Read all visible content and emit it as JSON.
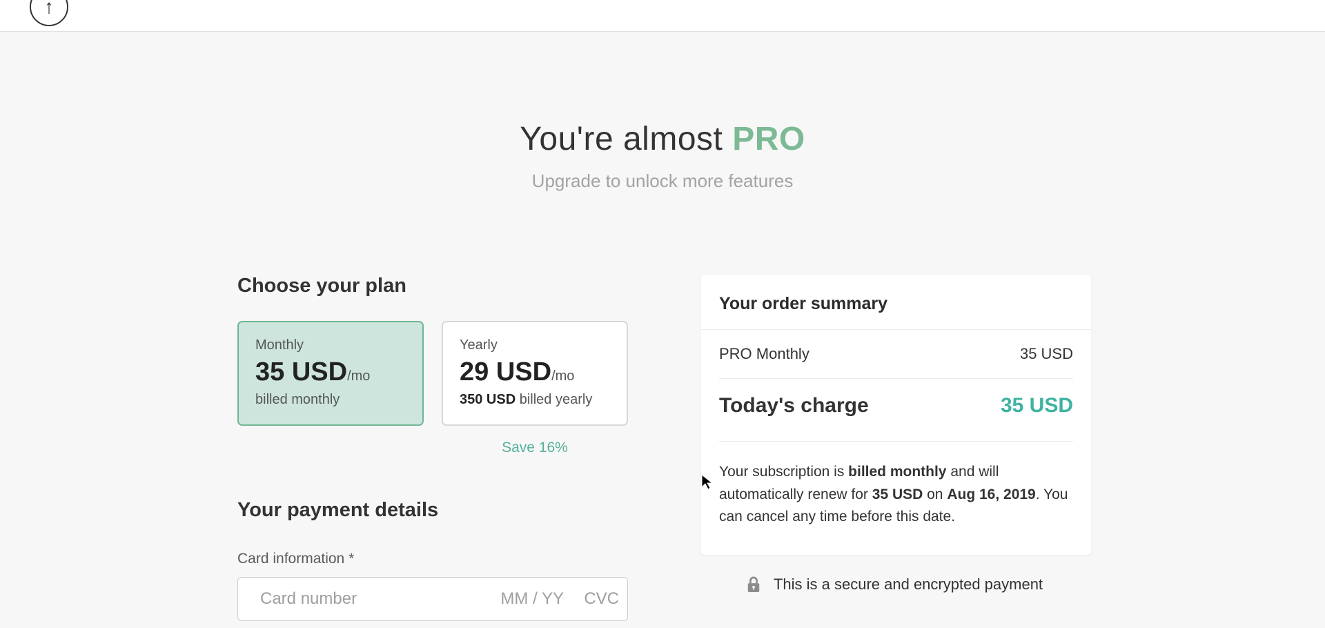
{
  "header": {
    "icon_text": "↑"
  },
  "hero": {
    "title_prefix": "You're almost ",
    "title_pro": "PRO",
    "subtitle": "Upgrade to unlock more features"
  },
  "plans": {
    "heading": "Choose your plan",
    "monthly": {
      "label": "Monthly",
      "price": "35 USD",
      "unit": "/mo",
      "billing": "billed monthly",
      "selected": true
    },
    "yearly": {
      "label": "Yearly",
      "price": "29 USD",
      "unit": "/mo",
      "billing_prefix": "350 USD",
      "billing_suffix": " billed yearly",
      "selected": false
    },
    "save_label": "Save 16%"
  },
  "payment": {
    "heading": "Your payment details",
    "card_label": "Card information *",
    "card_placeholder": "Card number",
    "exp_placeholder": "MM / YY",
    "cvc_placeholder": "CVC"
  },
  "summary": {
    "heading": "Your order summary",
    "item_name": "PRO Monthly",
    "item_price": "35 USD",
    "total_label": "Today's charge",
    "total_value": "35 USD",
    "note_prefix": "Your subscription is ",
    "note_billed": "billed monthly",
    "note_mid1": " and will automatically renew for ",
    "note_amount": "35 USD",
    "note_mid2": " on ",
    "note_date": "Aug 16, 2019",
    "note_suffix": ". You can cancel any time before this date.",
    "secure_text": "This is a secure and encrypted payment"
  }
}
